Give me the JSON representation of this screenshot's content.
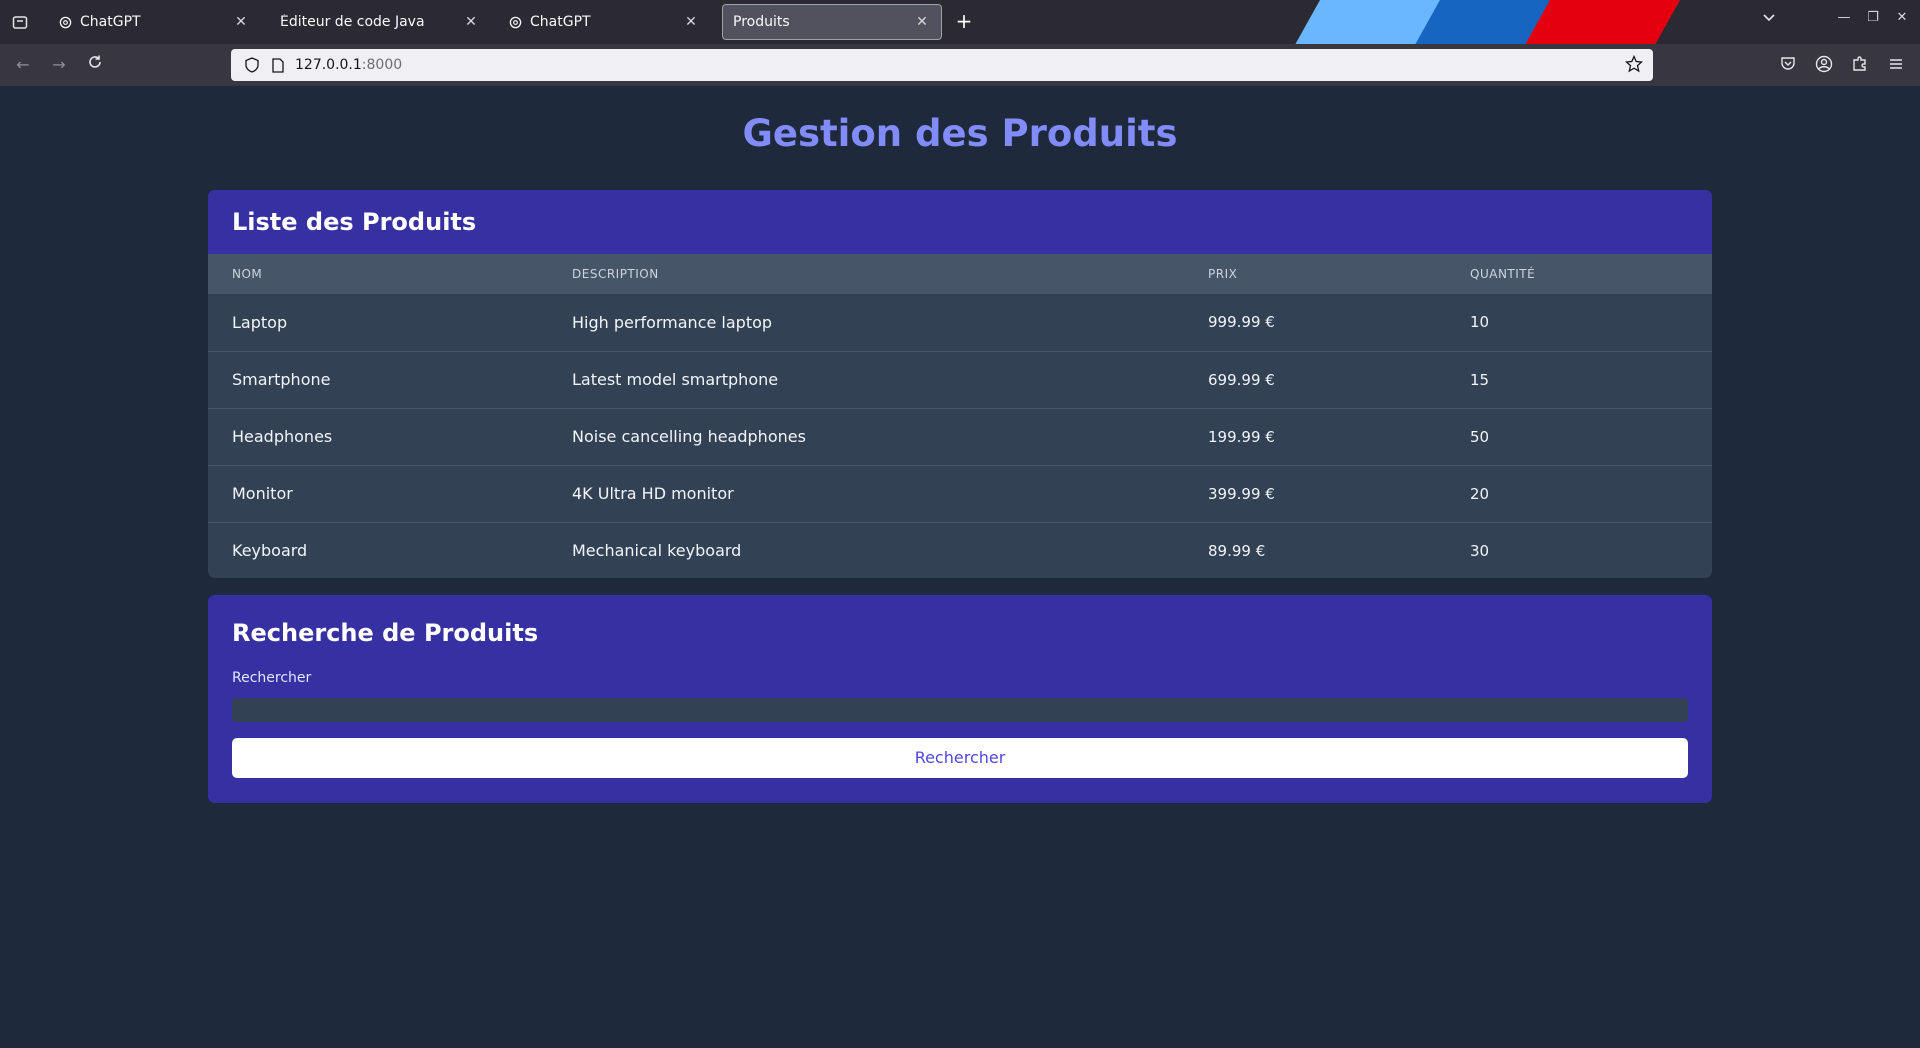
{
  "browser": {
    "tabs": [
      {
        "title": "ChatGPT",
        "icon": "chatgpt-favicon-icon",
        "active": false
      },
      {
        "title": "Éditeur de code Java",
        "icon": "",
        "active": false
      },
      {
        "title": "ChatGPT",
        "icon": "chatgpt-favicon-icon",
        "active": false
      },
      {
        "title": "Produits",
        "icon": "",
        "active": true
      }
    ],
    "url_host": "127.0.0.1",
    "url_port": ":8000",
    "colors": {
      "stripe_light": "#6ab7ff",
      "stripe_blue": "#1565c0",
      "stripe_red": "#e3000f"
    }
  },
  "page": {
    "title": "Gestion des Produits"
  },
  "product_list": {
    "title": "Liste des Produits",
    "columns": [
      "NOM",
      "DESCRIPTION",
      "PRIX",
      "QUANTITÉ"
    ],
    "rows": [
      {
        "name": "Laptop",
        "description": "High performance laptop",
        "price": "999.99 €",
        "quantity": "10"
      },
      {
        "name": "Smartphone",
        "description": "Latest model smartphone",
        "price": "699.99 €",
        "quantity": "15"
      },
      {
        "name": "Headphones",
        "description": "Noise cancelling headphones",
        "price": "199.99 €",
        "quantity": "50"
      },
      {
        "name": "Monitor",
        "description": "4K Ultra HD monitor",
        "price": "399.99 €",
        "quantity": "20"
      },
      {
        "name": "Keyboard",
        "description": "Mechanical keyboard",
        "price": "89.99 €",
        "quantity": "30"
      }
    ]
  },
  "search": {
    "title": "Recherche de Produits",
    "label": "Rechercher",
    "input_value": "",
    "button_label": "Rechercher"
  },
  "colors": {
    "background": "#1e293b",
    "card_header": "#3730a3",
    "table_body": "#334155",
    "title_accent": "#818cf8"
  }
}
